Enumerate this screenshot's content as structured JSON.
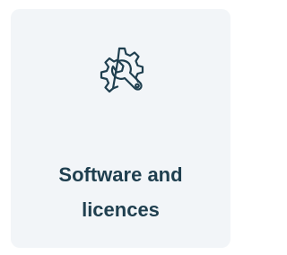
{
  "card": {
    "icon": "gear-wrench-icon",
    "title_line1": "Software and",
    "title_line2": "licences",
    "text_color": "#1f3f4f",
    "background_color": "#f2f5f8"
  }
}
